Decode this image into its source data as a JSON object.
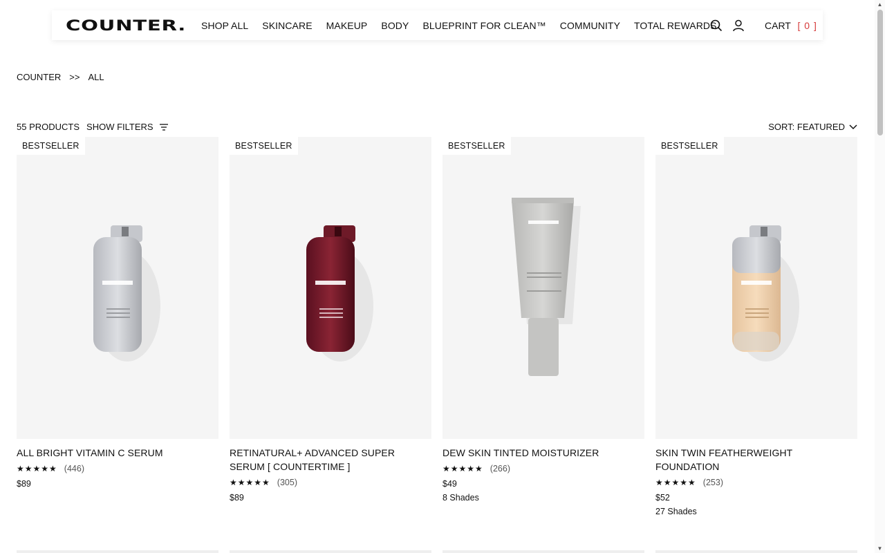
{
  "brand": {
    "logo_text": "COUNTER."
  },
  "nav": {
    "items": [
      {
        "label": "SHOP ALL"
      },
      {
        "label": "SKINCARE"
      },
      {
        "label": "MAKEUP"
      },
      {
        "label": "BODY"
      },
      {
        "label": "BLUEPRINT FOR CLEAN™"
      },
      {
        "label": "COMMUNITY"
      },
      {
        "label": "TOTAL REWARDS"
      }
    ]
  },
  "header": {
    "cart_label": "CART",
    "cart_count": "[ 0 ]",
    "search_icon": "search-icon",
    "account_icon": "user-icon",
    "cart_count_color": "#d63a3a"
  },
  "breadcrumb": {
    "root": "COUNTER",
    "separator": ">>",
    "current": "ALL"
  },
  "toolbar": {
    "product_count": "55 PRODUCTS",
    "filters_label": "SHOW FILTERS",
    "sort_label": "SORT: FEATURED"
  },
  "products": [
    {
      "badge": "BESTSELLER",
      "title": "ALL BRIGHT VITAMIN C SERUM",
      "stars": "★★★★★",
      "reviews": "(446)",
      "price": "$89",
      "shades": "",
      "bottle_color": "#c9cbd0"
    },
    {
      "badge": "BESTSELLER",
      "title": "RETINATURAL+ ADVANCED SUPER SERUM [ COUNTERTIME ]",
      "stars": "★★★★★",
      "reviews": "(305)",
      "price": "$89",
      "shades": "",
      "bottle_color": "#6e1a28"
    },
    {
      "badge": "BESTSELLER",
      "title": "DEW SKIN TINTED MOISTURIZER",
      "stars": "★★★★★",
      "reviews": "(266)",
      "price": "$49",
      "shades": "8 Shades",
      "bottle_color": "#c8c8c6"
    },
    {
      "badge": "BESTSELLER",
      "title": "SKIN TWIN FEATHERWEIGHT FOUNDATION",
      "stars": "★★★★★",
      "reviews": "(253)",
      "price": "$52",
      "shades": "27 Shades",
      "bottle_color": "#f1d3ae"
    }
  ]
}
